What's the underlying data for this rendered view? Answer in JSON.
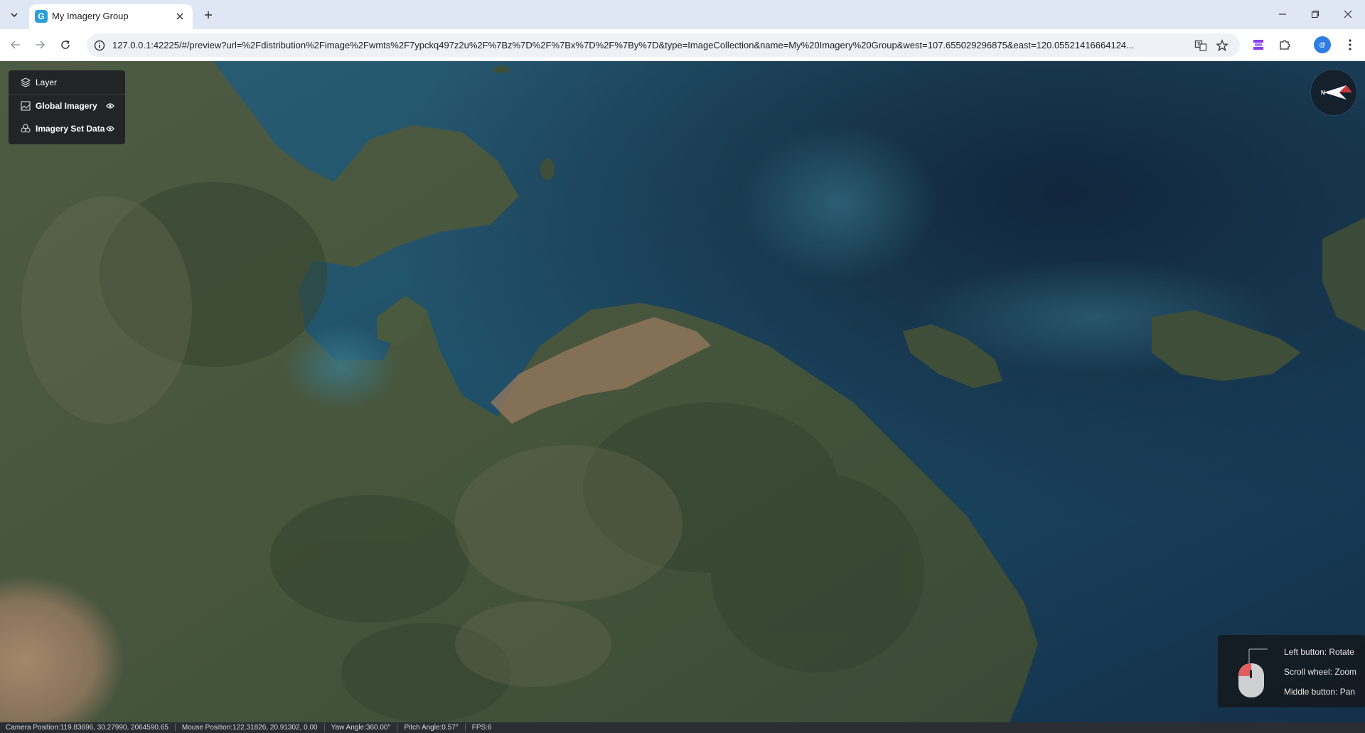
{
  "browser": {
    "tab_title": "My Imagery Group",
    "tab_favicon_letter": "G",
    "url": "127.0.0.1:42225/#/preview?url=%2Fdistribution%2Fimage%2Fwmts%2F7ypckq497z2u%2F%7Bz%7D%2F%7Bx%7D%2F%7By%7D&type=ImageCollection&name=My%20Imagery%20Group&west=107.655029296875&east=120.05521416664124...",
    "profile_initial": "@"
  },
  "layer_panel": {
    "header": "Layer",
    "items": [
      {
        "label": "Global Imagery",
        "visible": true
      },
      {
        "label": "Imagery Set Data",
        "visible": true
      }
    ]
  },
  "compass": {
    "north_label": "N"
  },
  "mouse_help": {
    "left": "Left button: Rotate",
    "scroll": "Scroll wheel: Zoom",
    "middle": "Middle button: Pan"
  },
  "status": {
    "camera": "Camera Position:119.83696, 30.27990, 2064590.65",
    "mouse": "Mouse Position:122.31826, 20.91302, 0.00",
    "yaw": "Yaw Angle:360.00°",
    "pitch": "Pitch Angle:0.57°",
    "fps": "FPS:6"
  },
  "colors": {
    "sea_deep": "#143049",
    "sea_shallow": "#275c74",
    "land": "#4a5a3e",
    "desert": "#9a7d62"
  }
}
